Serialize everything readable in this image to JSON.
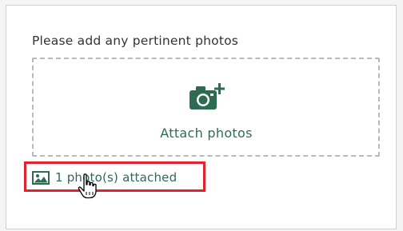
{
  "form": {
    "prompt": "Please add any pertinent photos",
    "attach_label": "Attach photos",
    "status_text": "1 photo(s) attached"
  },
  "icons": {
    "camera": "camera-add-icon",
    "image": "image-icon",
    "cursor": "hand-pointer-cursor"
  },
  "colors": {
    "accent_green": "#2e6b53",
    "highlight_red": "#e2232e",
    "text_dark": "#333333",
    "dashed_border": "#b9b9b9"
  }
}
